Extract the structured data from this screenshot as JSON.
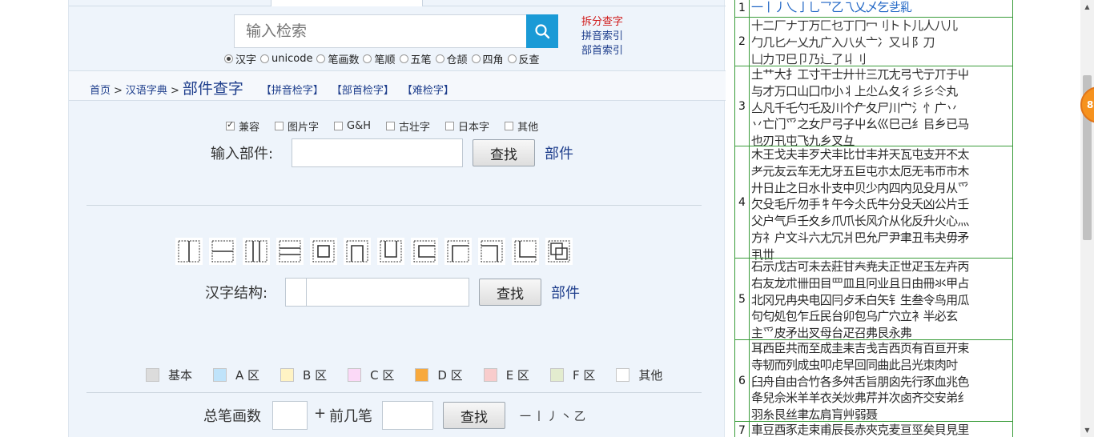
{
  "search": {
    "placeholder": "输入检索"
  },
  "side_links": [
    "拆分查字",
    "拼音索引",
    "部首索引"
  ],
  "search_modes": [
    {
      "label": "汉字",
      "checked": true
    },
    {
      "label": "unicode",
      "checked": false
    },
    {
      "label": "笔画数",
      "checked": false
    },
    {
      "label": "笔顺",
      "checked": false
    },
    {
      "label": "五笔",
      "checked": false
    },
    {
      "label": "仓颉",
      "checked": false
    },
    {
      "label": "四角",
      "checked": false
    },
    {
      "label": "反查",
      "checked": false
    }
  ],
  "breadcrumb": {
    "home": "首页",
    "sep": ">",
    "dict": "汉语字典",
    "current": "部件查字",
    "links": [
      "【拼音检字】",
      "【部首检字】",
      "【难检字】"
    ]
  },
  "filters": [
    {
      "label": "兼容",
      "checked": true
    },
    {
      "label": "图片字",
      "checked": false
    },
    {
      "label": "G&H",
      "checked": false
    },
    {
      "label": "古壮字",
      "checked": false
    },
    {
      "label": "日本字",
      "checked": false
    },
    {
      "label": "其他",
      "checked": false
    }
  ],
  "component_search": {
    "label": "输入部件:",
    "button": "查找",
    "link": "部件"
  },
  "structure_search": {
    "label": "汉字结构:",
    "button": "查找",
    "link": "部件"
  },
  "structure_buttons": [
    "left-right-icon",
    "top-bottom-icon",
    "left-middle-right-icon",
    "top-middle-bottom-icon",
    "full-enclosure-icon",
    "top-enclosure-icon",
    "bottom-enclosure-icon",
    "left-enclosure-icon",
    "upper-left-enclosure-icon",
    "upper-right-enclosure-icon",
    "lower-left-enclosure-icon",
    "overlap-icon"
  ],
  "legend": [
    {
      "label": "基本",
      "color": "#dcdcdc"
    },
    {
      "label": "A 区",
      "color": "#bfe3fa"
    },
    {
      "label": "B 区",
      "color": "#fff3c4"
    },
    {
      "label": "C 区",
      "color": "#fbd9f7"
    },
    {
      "label": "D 区",
      "color": "#f8a93c"
    },
    {
      "label": "E 区",
      "color": "#f8cccc"
    },
    {
      "label": "F 区",
      "color": "#e3eccf"
    },
    {
      "label": "其他",
      "color": "#ffffff"
    }
  ],
  "stroke_search": {
    "total_label": "总笔画数",
    "plus": "+",
    "first_label": "前几笔",
    "button": "查找",
    "glyphs": "一丨丿丶乙"
  },
  "component_table": [
    {
      "num": "1",
      "lines": [
        "一丨丿乀亅乚乛乙乁乂乄乞乧乿"
      ]
    },
    {
      "num": "2",
      "lines": [
        "十二厂ナ丁万匚乜丁冂冖刂ト卜儿人八儿",
        "勹几匕𠂉乂九广入八乆亠冫又丩阝刀",
        "凵力ㄗ巳卩乃辶了丩刂"
      ]
    },
    {
      "num": "3",
      "lines": [
        "土艹大扌工寸干士廾卄三兀尢弓弋亍丌于屮",
        "与才万口山囗巾小丬上尐ㄙ夂彳彡彡仒丸",
        "亼凡千乇勺乇及川个厃夂尸川宀氵忄广丷",
        "丷亡门爫之女尸弓子屮幺巛巳己纟㠯乡已马",
        "也刃卂屯飞九乡叉彑"
      ]
    },
    {
      "num": "4",
      "lines": [
        "木王戈夫丰歹犬丰比廿丰并天瓦屯支开不太",
        "耂元友云车无尢牙五巨屯朩太厄无韦帀市木",
        "廾日止之日水卝支中贝少内四内见殳月从爫",
        "欠殳毛斤勿手牜午今仌氏牛分殳夭凶公片壬",
        "父户气戶壬夊乡爪爪长风介从化反升火心灬",
        "方礻户文斗六尢冗爿巴允尸尹聿丑韦夬毋矛",
        "丮丗"
      ]
    },
    {
      "num": "5",
      "lines": [
        "石示戊古可未去莊甘𡗗尭夫正世疋玉左卉丙",
        "右友龙朮卌田目罒皿且冋业且日由冊氺甲占",
        "北冈兄冉央电囚冃歺禾白矢钅生叁令鸟用瓜",
        "句匂処包乍丘民台卯包乌广穴立衤半必玄",
        "主爫皮矛出㕚母台疋召弗艮永弗"
      ]
    },
    {
      "num": "6",
      "lines": [
        "耳西臣共而至成圭耒吉戋吉西页有百亘开束",
        "寺韧而列成虫叩虍早回同曲此吕光朿肉吋",
        "臼舟自由合竹各多舛舌旨朋囟先行豕血兆色",
        "夅兒佘米羊羊衣关炏弗芹并次卤齐交安弟纟",
        "羽糸艮丝聿厷肩肓艸弱聂"
      ]
    },
    {
      "num": "7",
      "lines": [
        "車豆酉豕走束甫辰長赤夾克麦亘巠矣貝見里"
      ]
    }
  ]
}
